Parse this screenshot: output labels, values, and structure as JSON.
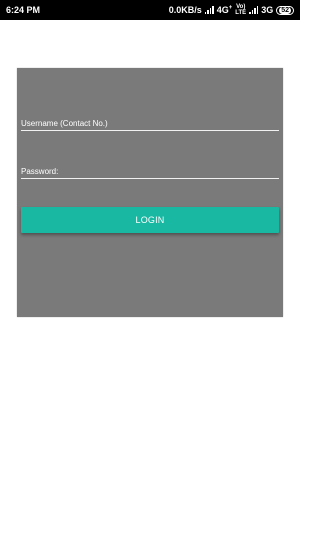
{
  "status_bar": {
    "time": "6:24 PM",
    "network_speed": "0.0KB/s",
    "net_label_1": "4G",
    "net_label_1_sup": "+",
    "volte_top": "Vo)",
    "volte_bottom": "LTE",
    "net_label_2": "3G",
    "battery": "52"
  },
  "form": {
    "username_placeholder": "Username (Contact No.)",
    "password_placeholder": "Password:",
    "login_label": "LOGIN"
  },
  "colors": {
    "panel": "#7a7a7a",
    "login_button": "#19b8a2"
  }
}
